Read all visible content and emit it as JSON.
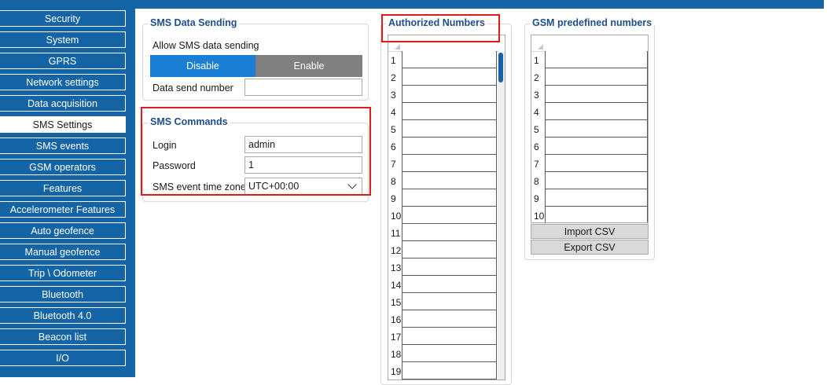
{
  "sidebar": {
    "items": [
      {
        "label": "Security"
      },
      {
        "label": "System"
      },
      {
        "label": "GPRS"
      },
      {
        "label": "Network settings"
      },
      {
        "label": "Data acquisition"
      },
      {
        "label": "SMS Settings",
        "active": true
      },
      {
        "label": "SMS events"
      },
      {
        "label": "GSM operators"
      },
      {
        "label": "Features"
      },
      {
        "label": "Accelerometer Features"
      },
      {
        "label": "Auto geofence"
      },
      {
        "label": "Manual geofence"
      },
      {
        "label": "Trip \\ Odometer"
      },
      {
        "label": "Bluetooth"
      },
      {
        "label": "Bluetooth 4.0"
      },
      {
        "label": "Beacon list"
      },
      {
        "label": "I/O"
      }
    ]
  },
  "sms_data_sending": {
    "title": "SMS Data Sending",
    "allow_label": "Allow SMS data sending",
    "disable_label": "Disable",
    "enable_label": "Enable",
    "selected": "Disable",
    "send_number_label": "Data send number",
    "send_number_value": ""
  },
  "sms_commands": {
    "title": "SMS Commands",
    "login_label": "Login",
    "login_value": "admin",
    "password_label": "Password",
    "password_value": "1",
    "timezone_label": "SMS event time zone",
    "timezone_value": "UTC+00:00"
  },
  "authorized_numbers": {
    "title": "Authorized Numbers",
    "rows": [
      "1",
      "2",
      "3",
      "4",
      "5",
      "6",
      "7",
      "8",
      "9",
      "10",
      "11",
      "12",
      "13",
      "14",
      "15",
      "16",
      "17",
      "18",
      "19"
    ]
  },
  "gsm_predefined": {
    "title": "GSM predefined numbers",
    "rows": [
      "1",
      "2",
      "3",
      "4",
      "5",
      "6",
      "7",
      "8",
      "9",
      "10"
    ],
    "import_label": "Import CSV",
    "export_label": "Export CSV"
  },
  "colors": {
    "accent": "#1565a6",
    "enabled_segment": "#1a7fd4",
    "highlight": "#e01b1b"
  }
}
